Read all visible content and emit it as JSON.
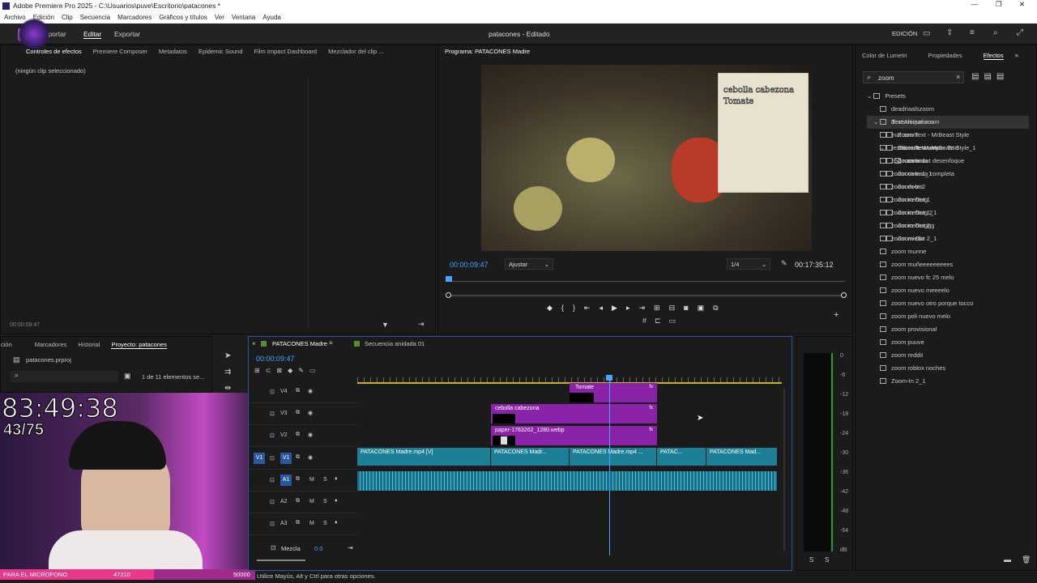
{
  "app": {
    "title": "Adobe Premiere Pro 2025 - C:\\Usuarios\\puve\\Escritorio\\patacones *",
    "menus": [
      "Archivo",
      "Edición",
      "Clip",
      "Secuencia",
      "Marcadores",
      "Gráficos y títulos",
      "Ver",
      "Ventana",
      "Ayuda"
    ]
  },
  "workspace": {
    "tabs": [
      "Importar",
      "Editar",
      "Exportar"
    ],
    "active": "Editar",
    "project": "patacones - Editado",
    "mode": "EDICIÓN"
  },
  "effect_controls": {
    "tabs": [
      "Controles de efectos",
      "Premiere Composer",
      "Metadatos",
      "Epidemic Sound",
      "Film Impact Dashboard",
      "Mezclador del clip ..."
    ],
    "empty": "(ningún clip seleccionado)",
    "time": "00:00:09:47"
  },
  "program": {
    "title": "Programa: PATACONES Madre",
    "overlay_lines": [
      "cebolla cabezona",
      "Tomate"
    ],
    "timecode": "00:00:09:47",
    "fit": "Ajustar",
    "quality": "1/4",
    "duration": "00:17:35:12"
  },
  "project": {
    "tabs": [
      "ción",
      "Marcadores",
      "Historial",
      "Proyecto: patacones"
    ],
    "file": "patacones.prproj",
    "count": "1 de 11 elementos se..."
  },
  "stream": {
    "timer": "83:49:38",
    "count": "43/75",
    "banner": "PARA EL MICROFONO",
    "banner_count": "47210",
    "goal": "50000"
  },
  "timeline": {
    "tabs": [
      "PATACONES Madre",
      "Secuencia anidada 01"
    ],
    "timecode": "00:00:09:47",
    "tracks": [
      "V4",
      "V3",
      "V2",
      "V1",
      "A1",
      "A2",
      "A3"
    ],
    "mix": "Mezcla",
    "mix_value": "0.0",
    "clips": {
      "tomate": "Tomate",
      "cebolla": "cebolla cabezona",
      "paper": "paper-1763262_1280.webp",
      "v1a": "PATACONES Madre.mp4 [V]",
      "v1b": "PATACONES Madr...",
      "v1c": "PATACONES Madre.mp4 ...",
      "v1d": "PATAC...",
      "v1e": "PATACONES Mad..."
    }
  },
  "meter": {
    "ticks": [
      "0",
      "-6",
      "-12",
      "-18",
      "-24",
      "-30",
      "-36",
      "-42",
      "-48",
      "-54",
      "dB"
    ],
    "channels": [
      "S",
      "S"
    ]
  },
  "effects": {
    "tabs": [
      "Color de Lumetri",
      "Propiedades",
      "Efectos"
    ],
    "search": "zoom",
    "presets_label": "Presets",
    "presets": [
      "deadriaalszoom",
      "desenfoque zoom",
      "fnaf zoom",
      "restaurante zoom",
      "zoom camara",
      "zoom camara completa",
      "zoom doors",
      "zoom iceberg",
      "zoom iceberg 2",
      "zoom iceberggg",
      "zoom miedo",
      "zoom munne",
      "zoom muñeeeeeeeees",
      "zoom nuevo fc 25 melo",
      "zoom nuevo meeeelo",
      "zoom nuevo otro porque tocco",
      "zoom peli nuevo melo",
      "zoom provisional",
      "zoom puuve",
      "zoom reddit",
      "zoom roblox noches",
      "Zoom-In 2_1"
    ],
    "text_anim_label": "Text Animations",
    "text_anim": [
      "Zoom Text - MrBeast Style",
      "Zoom Text - MrBeast Style_1",
      "Zoom-In 1",
      "Zoom-In 1_1",
      "Zoom-In 2",
      "Zoom-Out 1",
      "Zoom-Out 1_1",
      "Zoom-Out 2",
      "Zoom-Out 2_1"
    ],
    "wumpus_label": "Ultimate Wumpus Text",
    "wumpus": [
      "zoom out desenfoque"
    ]
  },
  "status": "Utilice Mayús, Alt y Ctrl para otras opciones."
}
